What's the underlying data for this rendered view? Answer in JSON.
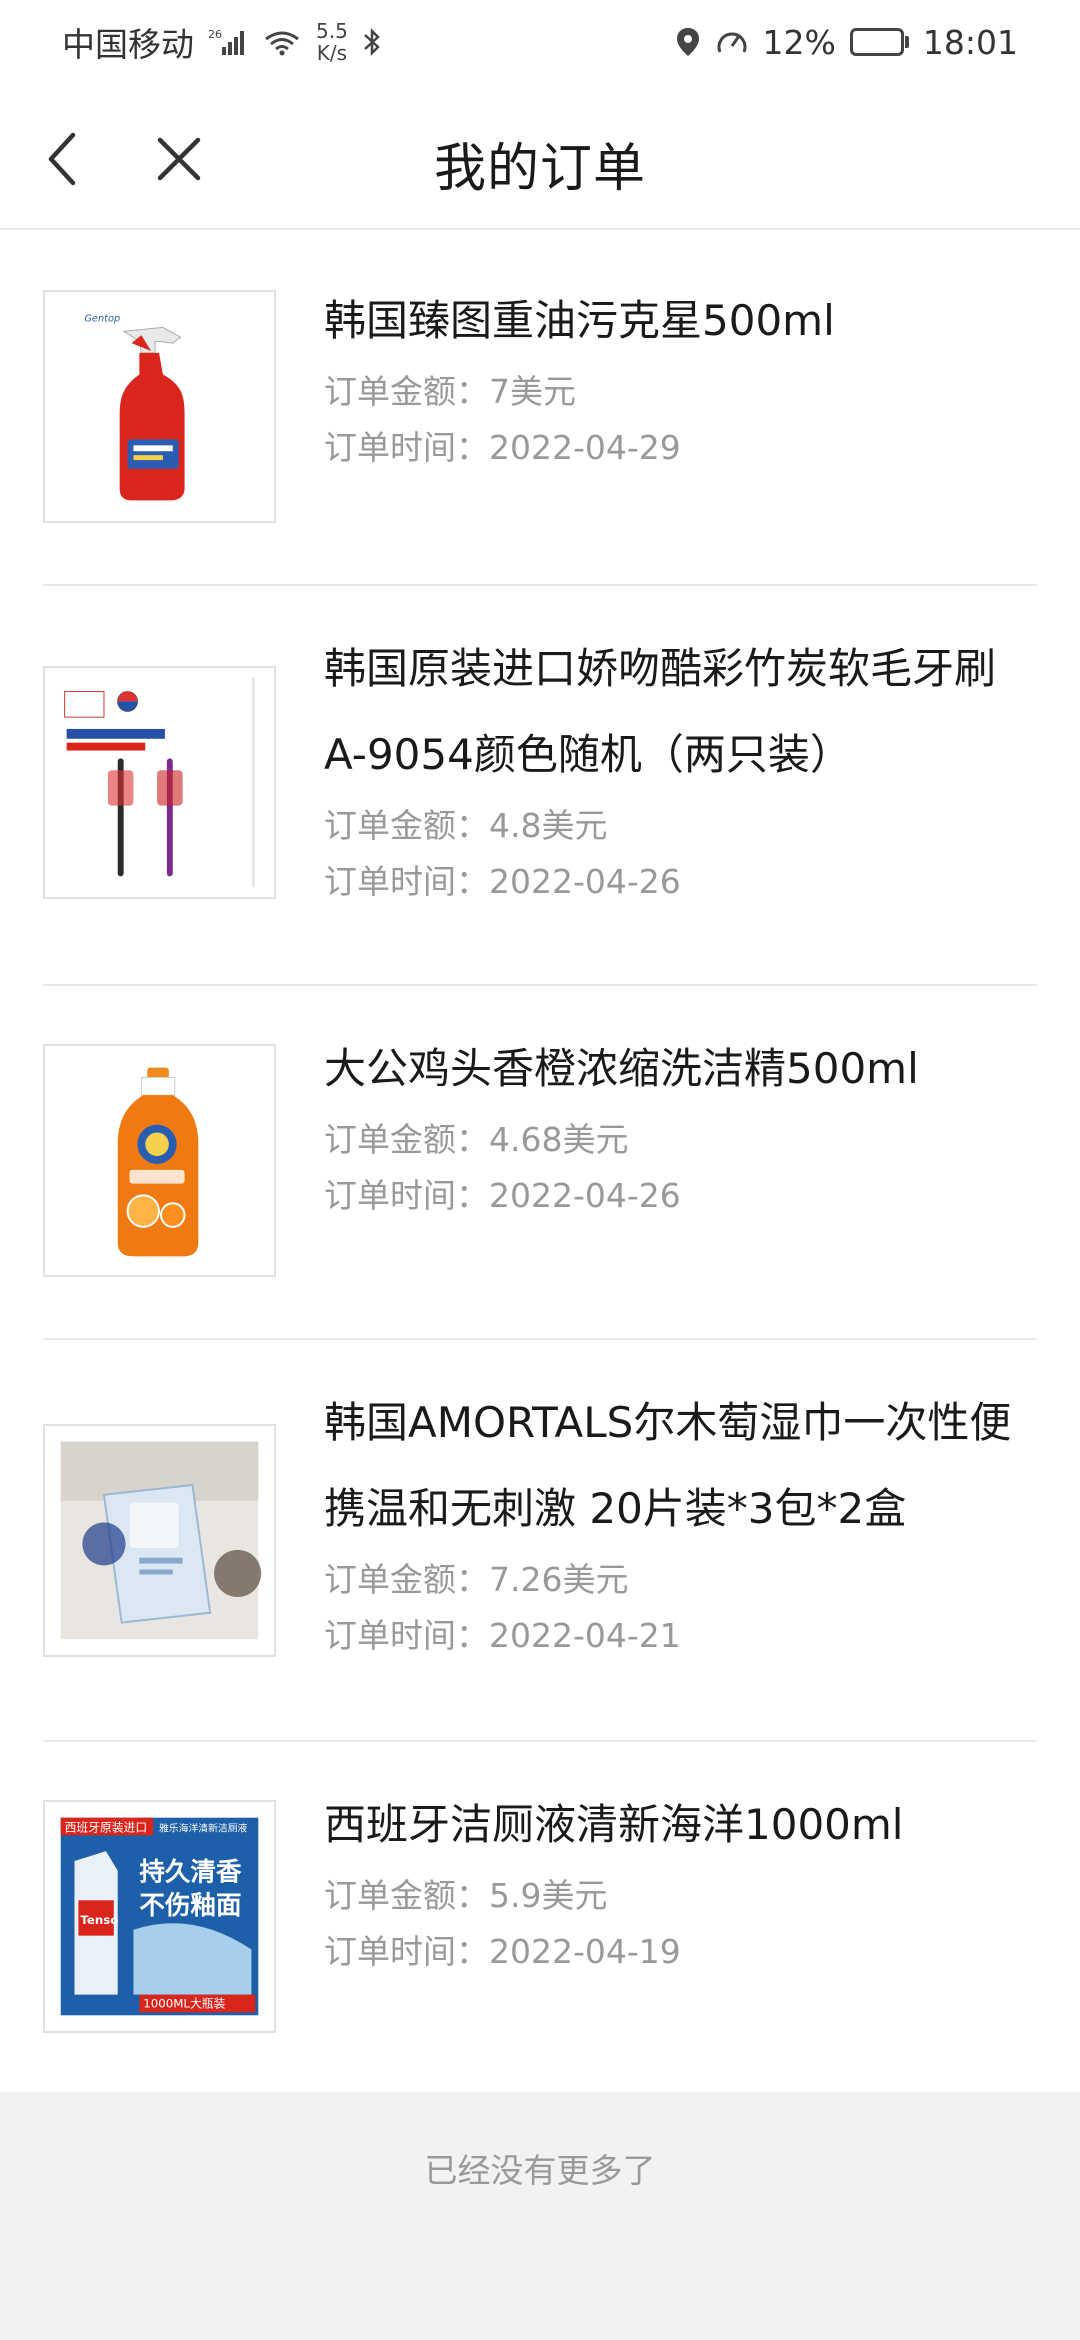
{
  "status_bar": {
    "carrier": "中国移动",
    "network": "26",
    "speed_value": "5.5",
    "speed_unit": "K/s",
    "battery_percent": "12%",
    "battery_level": 0.12,
    "time": "18:01"
  },
  "header": {
    "title": "我的订单",
    "back_icon": "chevron-left-icon",
    "close_icon": "close-icon"
  },
  "orders": [
    {
      "title": "韩国臻图重油污克星500ml",
      "amount_label": "订单金额：",
      "amount": "7美元",
      "time_label": "订单时间：",
      "time": "2022-04-29",
      "image": "red-spray-bottle"
    },
    {
      "title": "韩国原装进口娇吻酷彩竹炭软毛牙刷A-9054颜色随机（两只装）",
      "amount_label": "订单金额：",
      "amount": "4.8美元",
      "time_label": "订单时间：",
      "time": "2022-04-26",
      "image": "toothbrush-pack"
    },
    {
      "title": "大公鸡头香橙浓缩洗洁精500ml",
      "amount_label": "订单金额：",
      "amount": "4.68美元",
      "time_label": "订单时间：",
      "time": "2022-04-26",
      "image": "orange-detergent-bottle"
    },
    {
      "title": "韩国AMORTALS尔木萄湿巾一次性便携温和无刺激 20片装*3包*2盒",
      "amount_label": "订单金额：",
      "amount": "7.26美元",
      "time_label": "订单时间：",
      "time": "2022-04-21",
      "image": "wet-wipes-pack"
    },
    {
      "title": "西班牙洁厕液清新海洋1000ml",
      "amount_label": "订单金额：",
      "amount": "5.9美元",
      "time_label": "订单时间：",
      "time": "2022-04-19",
      "image": "toilet-cleaner-ad",
      "image_texts": {
        "banner_left": "西班牙原装进口",
        "banner_right": "雅乐海洋清新洁厕液",
        "headline_1": "持久清香",
        "headline_2": "不伤釉面",
        "brand": "Tenso",
        "size_tag": "1000ML大瓶装"
      }
    }
  ],
  "footer": {
    "no_more_text": "已经没有更多了"
  },
  "colors": {
    "divider": "#e6e6e6",
    "meta_text": "#999999",
    "battery": "#f0a020",
    "footer_bg": "#f2f2f4"
  }
}
